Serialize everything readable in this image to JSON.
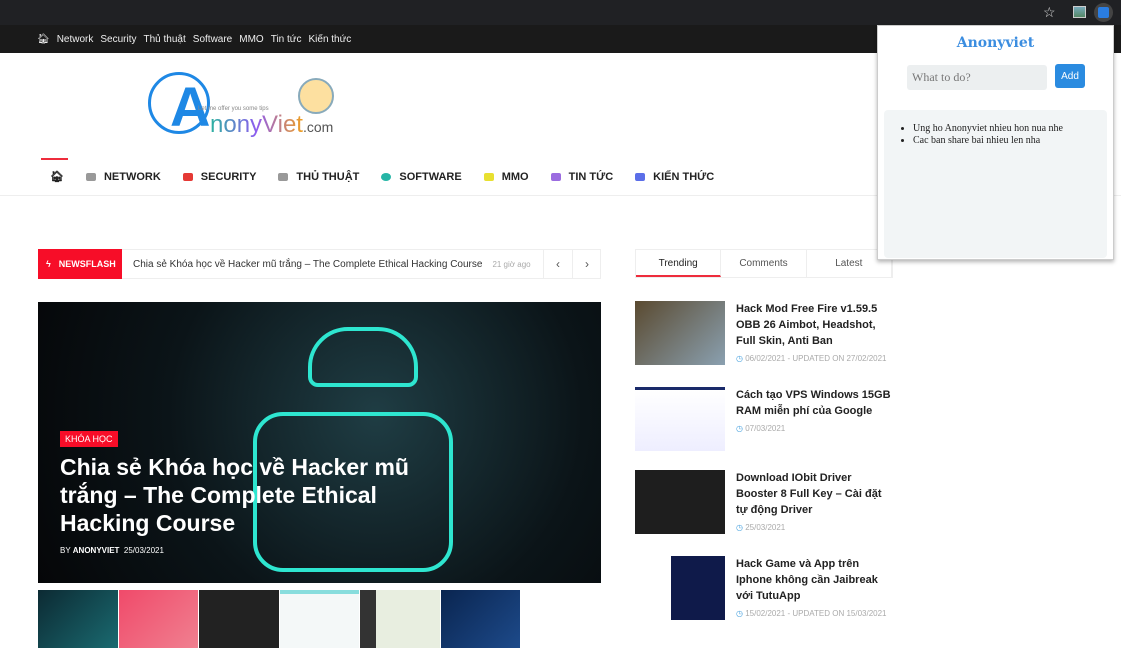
{
  "browser": {
    "icons": [
      "star-icon",
      "image-extension-icon",
      "anonyviet-extension-icon"
    ]
  },
  "topnav": {
    "items": [
      "Network",
      "Security",
      "Thủ thuật",
      "Software",
      "MMO",
      "Tin tức",
      "Kiến thức"
    ]
  },
  "logo": {
    "letter": "A",
    "rest": "nonyViet",
    "suffix": ".com",
    "tagline": "Let me offer you some tips"
  },
  "mainnav": {
    "items": [
      {
        "label": "NETWORK",
        "color": "#999999"
      },
      {
        "label": "SECURITY",
        "color": "#e53935"
      },
      {
        "label": "THỦ THUẬT",
        "color": "#999999"
      },
      {
        "label": "SOFTWARE",
        "color": "#26b5a6"
      },
      {
        "label": "MMO",
        "color": "#e8e030"
      },
      {
        "label": "TIN TỨC",
        "color": "#9b6ce0"
      },
      {
        "label": "KIẾN THỨC",
        "color": "#5b6ee8"
      }
    ]
  },
  "newsflash": {
    "label": "NEWSFLASH",
    "title": "Chia sẻ Khóa học về Hacker mũ trắng – The Complete Ethical Hacking Course",
    "ago": "21 giờ ago",
    "prev": "‹",
    "next": "›"
  },
  "hero": {
    "category": "KHÓA HỌC",
    "title": "Chia sẻ Khóa học về Hacker mũ trắng – The Complete Ethical Hacking Course",
    "by": "BY",
    "author": "ANONYVIET",
    "date": "25/03/2021"
  },
  "sidebar": {
    "tabs": [
      "Trending",
      "Comments",
      "Latest"
    ],
    "posts": [
      {
        "title": "Hack Mod Free Fire v1.59.5 OBB 26 Aimbot, Headshot, Full Skin, Anti Ban",
        "date": "06/02/2021 - UPDATED ON 27/02/2021"
      },
      {
        "title": "Cách tạo VPS Windows 15GB RAM miễn phí của Google",
        "date": "07/03/2021"
      },
      {
        "title": "Download IObit Driver Booster 8 Full Key – Cài đặt tự động Driver",
        "date": "25/03/2021"
      },
      {
        "title": "Hack Game và App trên Iphone không cần Jaibreak với TutuApp",
        "date": "15/02/2021 - UPDATED ON 15/03/2021"
      }
    ]
  },
  "popup": {
    "title": "Anonyviet",
    "placeholder": "What to do?",
    "add": "Add",
    "items": [
      "Ung ho Anonyviet nhieu hon nua nhe",
      "Cac ban share bai nhieu len nha"
    ]
  }
}
